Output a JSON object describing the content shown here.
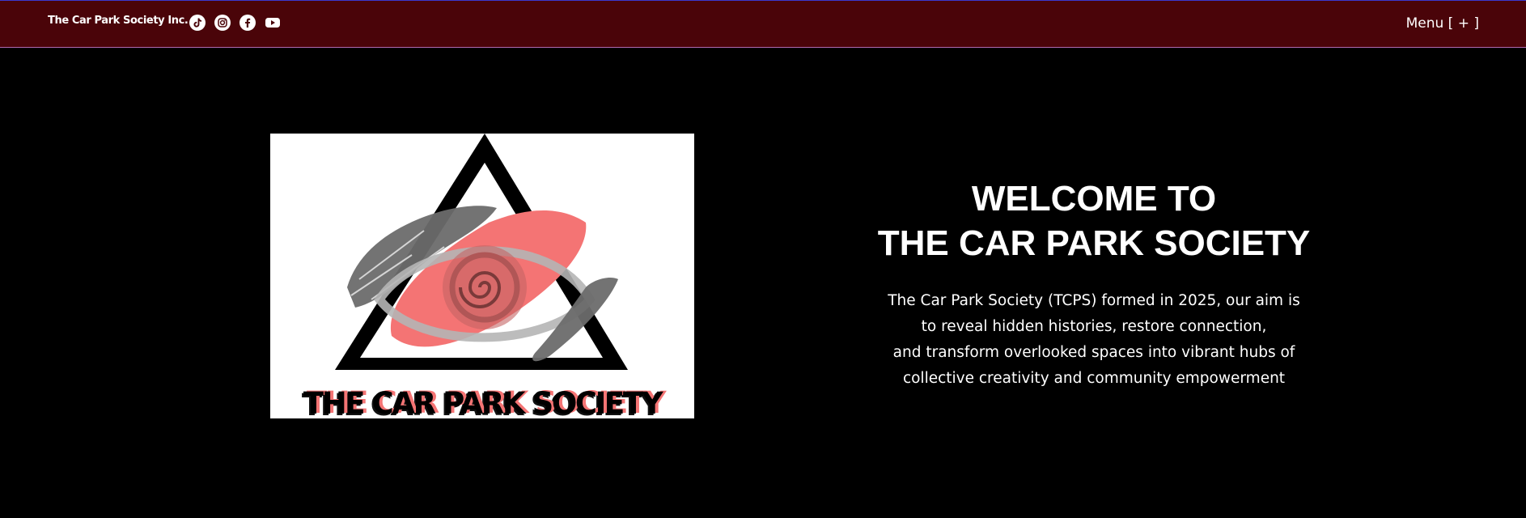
{
  "header": {
    "brand": "The Car Park Society Inc.",
    "socials": [
      {
        "name": "tiktok-icon"
      },
      {
        "name": "instagram-icon"
      },
      {
        "name": "facebook-icon"
      },
      {
        "name": "youtube-icon"
      }
    ],
    "menu_label": "Menu [ + ]"
  },
  "logo": {
    "text": "THE CAR PARK SOCIETY",
    "colors": {
      "accent": "#f47474",
      "gray": "#6b6b6b",
      "light_gray": "#b5b5b5"
    }
  },
  "hero": {
    "title_line1": "WELCOME TO",
    "title_line2": "THE CAR PARK SOCIETY",
    "description": [
      "The Car Park Society (TCPS) formed in 2025, our aim is",
      "to reveal hidden histories, restore connection,",
      "and transform overlooked spaces into vibrant hubs of",
      "collective creativity and community empowerment"
    ]
  },
  "colors": {
    "header_bg": "#4a0409",
    "page_bg": "#000000",
    "text": "#ffffff"
  }
}
